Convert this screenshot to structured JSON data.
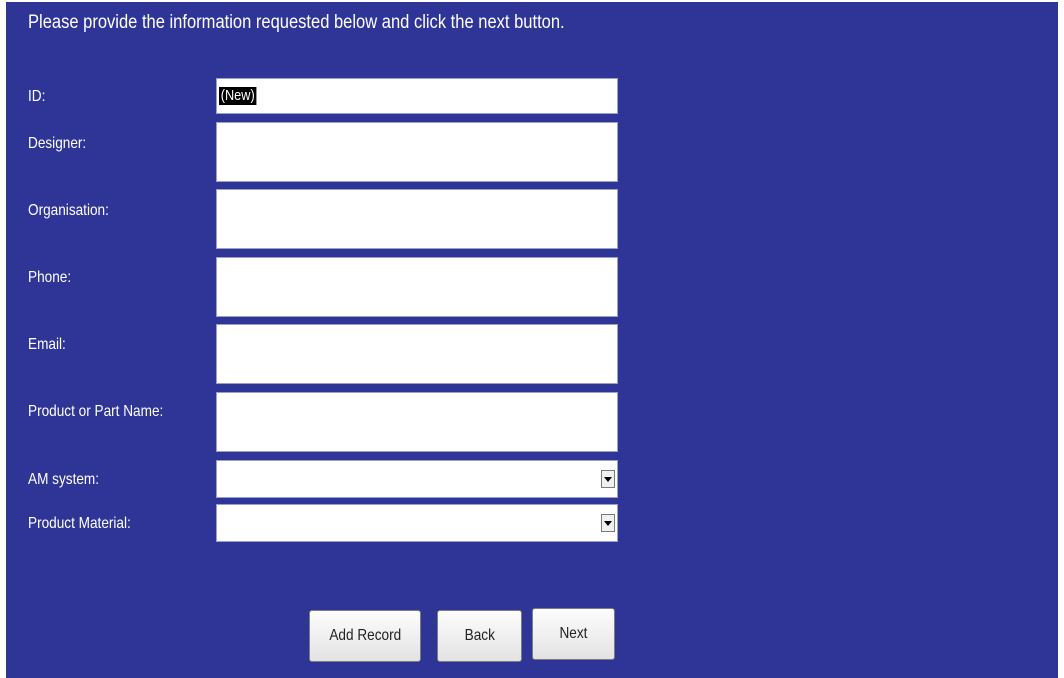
{
  "instruction": "Please provide the information requested below and click the next button.",
  "fields": {
    "id": {
      "label": "ID:",
      "value": "(New)"
    },
    "designer": {
      "label": "Designer:",
      "value": ""
    },
    "organisation": {
      "label": "Organisation:",
      "value": ""
    },
    "phone": {
      "label": "Phone:",
      "value": ""
    },
    "email": {
      "label": "Email:",
      "value": ""
    },
    "product_name": {
      "label": "Product or Part Name:",
      "value": ""
    },
    "am_system": {
      "label": "AM system:",
      "value": ""
    },
    "product_material": {
      "label": "Product Material:",
      "value": ""
    }
  },
  "buttons": {
    "add_record": "Add Record",
    "back": "Back",
    "next": "Next"
  },
  "colors": {
    "panel_background": "#2e3596",
    "label_text": "#ffffff",
    "selection_highlight": "#000000"
  },
  "icons": {
    "dropdown": "chevron-down-icon"
  }
}
